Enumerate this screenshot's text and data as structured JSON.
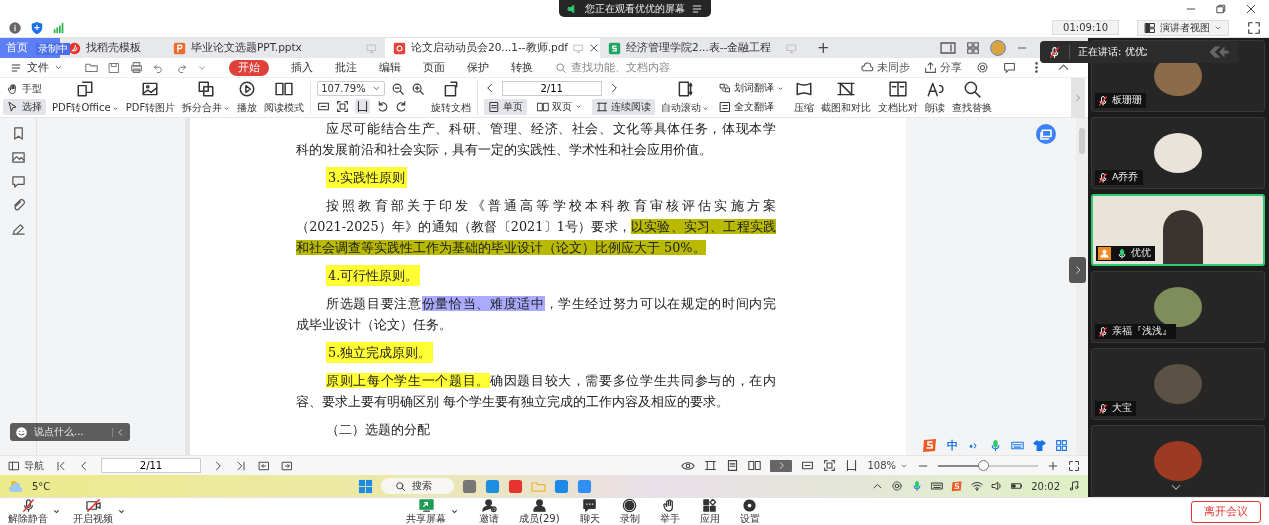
{
  "meeting": {
    "notice": "您正在观看优优的屏幕",
    "timer": "01:09:10",
    "view_button": "演讲者视图",
    "speaking": "正在讲话: 优优;"
  },
  "wps": {
    "tabs": [
      {
        "label": "首页",
        "selected": false,
        "kind": "home"
      },
      {
        "label": "找稻壳模板",
        "selected": false,
        "kind": "template"
      },
      {
        "label": "毕业论文选题PPT.pptx",
        "selected": false,
        "kind": "slides"
      },
      {
        "label": "论文启动动员会20...1--教师.pdf",
        "selected": true,
        "kind": "pdf"
      },
      {
        "label": "经济管理学院2...表--金融工程",
        "selected": false,
        "kind": "sheet"
      }
    ],
    "recording_badge": "录制中",
    "new_tab": "+",
    "menu": {
      "file": "文件",
      "items": [
        {
          "label": "开始",
          "selected": true
        },
        {
          "label": "插入",
          "selected": false
        },
        {
          "label": "批注",
          "selected": false
        },
        {
          "label": "编辑",
          "selected": false
        },
        {
          "label": "页面",
          "selected": false
        },
        {
          "label": "保护",
          "selected": false
        },
        {
          "label": "转换",
          "selected": false
        }
      ],
      "search_placeholder": "查找功能、文档内容",
      "sync": "未同步",
      "share": "分享"
    },
    "toolbar": {
      "modes": [
        {
          "label": "手型",
          "selected": false
        },
        {
          "label": "选择",
          "selected": true
        }
      ],
      "left_buttons": [
        {
          "label": "PDF转Office",
          "dropdown": true
        },
        {
          "label": "PDF转图片",
          "dropdown": false
        },
        {
          "label": "拆分合并",
          "dropdown": true
        },
        {
          "label": "播放",
          "dropdown": false
        },
        {
          "label": "阅读模式",
          "dropdown": false
        }
      ],
      "zoom": "107.79%",
      "rotate": "旋转文档",
      "page": "2/11",
      "views": [
        {
          "label": "单页",
          "selected": true,
          "dropdown": false
        },
        {
          "label": "双页",
          "selected": false,
          "dropdown": true
        },
        {
          "label": "连续阅读",
          "selected": true,
          "dropdown": false
        }
      ],
      "autoscroll": {
        "label": "自动滚动",
        "dropdown": true
      },
      "translate": [
        {
          "label": "划词翻译",
          "dropdown": true
        },
        {
          "label": "全文翻译",
          "dropdown": false
        }
      ],
      "right_buttons": [
        {
          "label": "压缩"
        },
        {
          "label": "截图和对比"
        },
        {
          "label": "文档比对"
        },
        {
          "label": "朗读"
        },
        {
          "label": "查找替换"
        }
      ]
    },
    "chat_placeholder": "说点什么...",
    "document": {
      "blocks": [
        {
          "kind": "paragraph",
          "lines": [
            [
              {
                "text": "应尽可能结合生产、科研、管理、经济、社会、文化等具体任务，体现本学"
              }
            ],
            [
              {
                "text": "科的发展前沿和社会实际，具有一定的实践性、学术性和社会应用价值。"
              }
            ]
          ]
        },
        {
          "kind": "heading",
          "text": "3.实践性原则",
          "color": "#ffff33"
        },
        {
          "kind": "paragraph",
          "lines": [
            [
              {
                "text": "按照教育部关于印发《普通高等学校本科教育审核评估实施方案"
              }
            ],
            [
              {
                "text": "（2021-2025）年》的通知（教督〔2021〕1号）要求，"
              },
              {
                "text": "以实验、实习、工程实践",
                "color": "#b9b900"
              }
            ],
            [
              {
                "text": "和社会调查等实践性工作为基础的毕业设计（论文）比例应大于 50%。",
                "color": "#b9b900"
              }
            ]
          ]
        },
        {
          "kind": "heading",
          "text": "4.可行性原则。",
          "color": "#ffff33"
        },
        {
          "kind": "paragraph",
          "lines": [
            [
              {
                "text": "所选题目要注意"
              },
              {
                "text": "份量恰当、难度适中",
                "color": "#aaaaff"
              },
              {
                "text": "，学生经过努力可以在规定的时间内完"
              }
            ],
            [
              {
                "text": "成毕业设计（论文）任务。"
              }
            ]
          ]
        },
        {
          "kind": "heading",
          "text": "5.独立完成原则。",
          "color": "#ffff33"
        },
        {
          "kind": "paragraph",
          "lines": [
            [
              {
                "text": "原则上每个学生一个题目。",
                "color": "#ffff33"
              },
              {
                "text": "确因题目较大，需要多位学生共同参与的，在内"
              }
            ],
            [
              {
                "text": "容、要求上要有明确区别 每个学生要有独立完成的工作内容及相应的要求。"
              }
            ]
          ]
        },
        {
          "kind": "paragraph",
          "lines": [
            [
              {
                "text": "（二）选题的分配"
              }
            ]
          ]
        }
      ]
    },
    "ime": {
      "mode": "中"
    },
    "status_bar": {
      "nav": "导航",
      "page": "2/11",
      "zoom": "108%",
      "zoom_slider": {
        "level": 0.45
      }
    },
    "taskbar": {
      "temperature": "5°C",
      "search": "搜索",
      "clock": "20:02"
    }
  },
  "participants": [
    {
      "name": "板珊珊",
      "kind": "avatar",
      "muted": true,
      "speaking": false
    },
    {
      "name": "A乔乔",
      "kind": "avatar",
      "muted": true,
      "speaking": false
    },
    {
      "name": "优优",
      "kind": "video",
      "muted": false,
      "speaking": true
    },
    {
      "name": "亲福『浅浅』",
      "kind": "avatar",
      "muted": true,
      "speaking": false
    },
    {
      "name": "大宝",
      "kind": "avatar",
      "muted": true,
      "speaking": false
    },
    {
      "kind": "avatar",
      "speaking": false
    }
  ],
  "controls": {
    "left": [
      {
        "label": "解除静音",
        "dropdown": true
      },
      {
        "label": "开启视频",
        "dropdown": true
      }
    ],
    "center": [
      {
        "label": "共享屏幕",
        "dropdown": true
      },
      {
        "label": "邀请",
        "dropdown": false
      },
      {
        "label": "成员(29)",
        "dropdown": false
      },
      {
        "label": "聊天",
        "dropdown": false
      },
      {
        "label": "录制",
        "dropdown": false
      },
      {
        "label": "举手",
        "dropdown": false
      },
      {
        "label": "应用",
        "dropdown": false
      },
      {
        "label": "设置",
        "dropdown": false
      }
    ],
    "leave": "离开会议"
  }
}
